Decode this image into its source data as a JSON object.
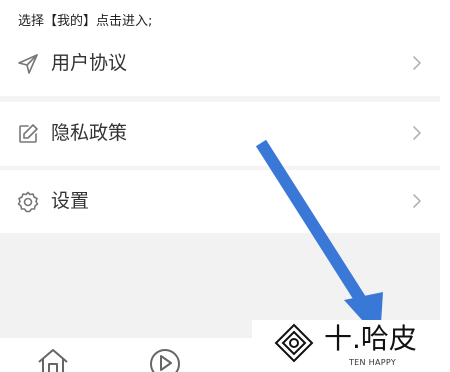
{
  "instruction_text": "选择【我的】点击进入;",
  "menu": {
    "items": [
      {
        "label": "用户协议",
        "icon": "send-icon"
      },
      {
        "label": "隐私政策",
        "icon": "edit-icon"
      },
      {
        "label": "设置",
        "icon": "gear-icon"
      }
    ]
  },
  "bottom_nav": {
    "items": [
      {
        "icon": "home-icon"
      },
      {
        "icon": "play-icon"
      }
    ]
  },
  "annotation": {
    "arrow_color": "#3a78d8"
  },
  "watermark": {
    "brand": "十.哈皮",
    "tagline": "TEN HAPPY",
    "icon": "diamond-logo-icon"
  }
}
